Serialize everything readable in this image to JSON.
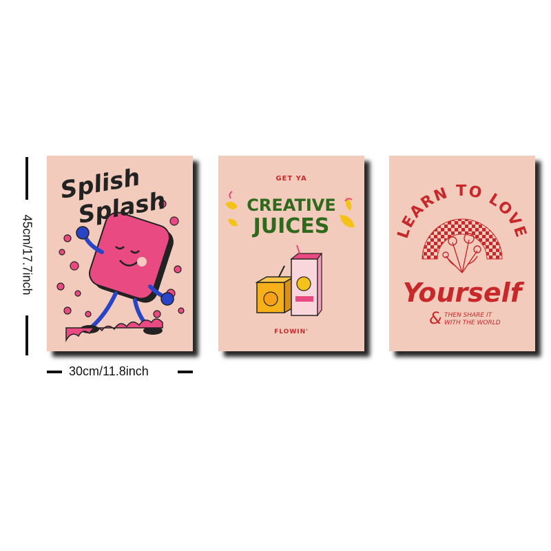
{
  "dimensions": {
    "height_label": "45cm/17.7inch",
    "width_label": "30cm/11.8inch"
  },
  "posters": [
    {
      "title_line1": "Splish",
      "title_line2": "Splash",
      "icon": "soap-character-icon"
    },
    {
      "top_text": "GET YA",
      "title_line1": "CREATIVE",
      "title_line2": "JUICES",
      "bottom_text": "FLOWIN'",
      "icon": "juice-boxes-icon"
    },
    {
      "arc_text": "LEARN TO LOVE",
      "script_text": "Yourself",
      "ampersand": "&",
      "line1": "THEN SHARE IT",
      "line2": "WITH THE WORLD",
      "icon": "flower-bouquet-icon"
    }
  ],
  "colors": {
    "poster_bg": "#f2cbbc",
    "pink": "#e94a82",
    "green": "#2f6a1c",
    "red": "#c8282a",
    "yellow": "#f5c21a"
  }
}
